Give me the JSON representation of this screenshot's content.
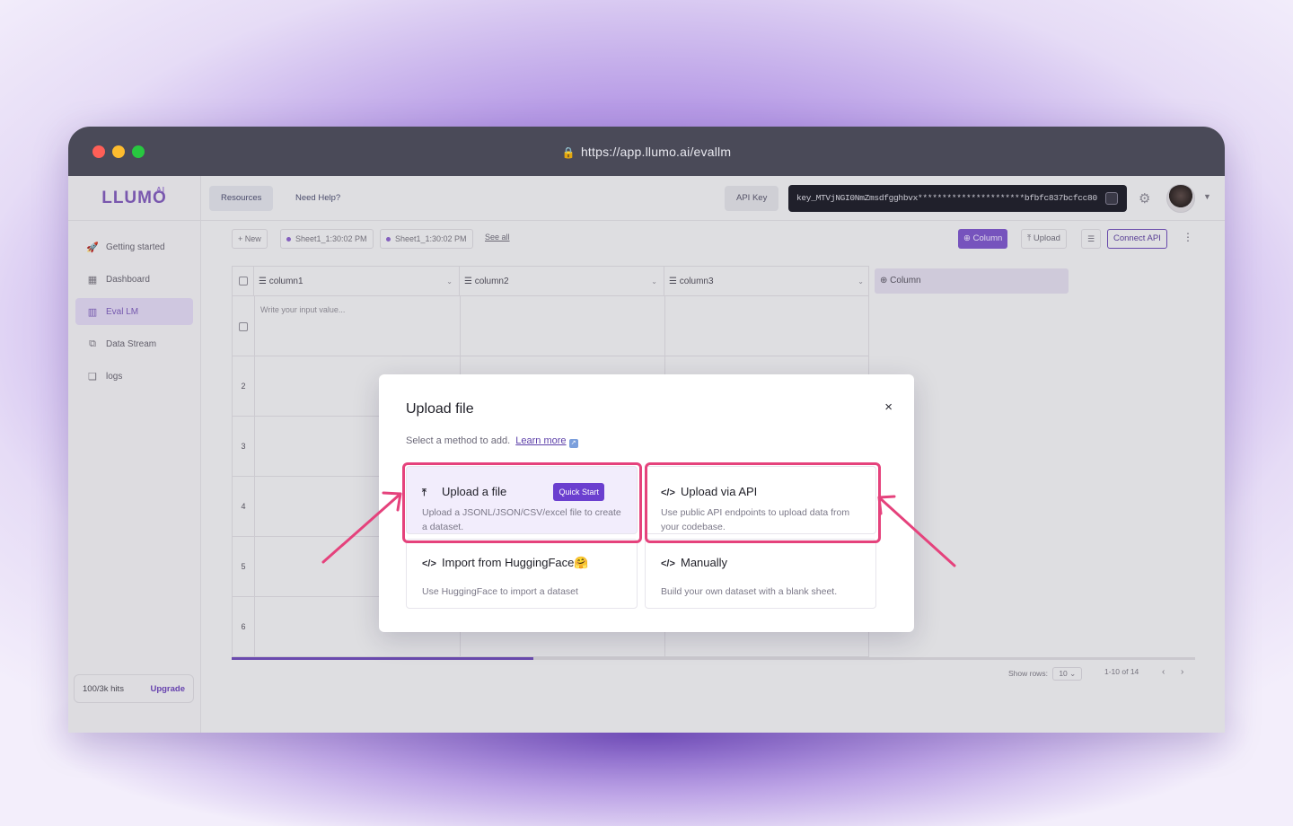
{
  "browser": {
    "url": "https://app.llumo.ai/evallm"
  },
  "brand": {
    "logo_text": "LLUMO",
    "logo_sup": "AI",
    "accent": "#6b3fcf",
    "highlight": "#e5427c"
  },
  "sidebar": {
    "items": [
      {
        "label": "Getting started",
        "icon": "rocket-icon"
      },
      {
        "label": "Dashboard",
        "icon": "dashboard-icon"
      },
      {
        "label": "Eval LM",
        "icon": "chart-icon",
        "active": true
      },
      {
        "label": "Data Stream",
        "icon": "flow-icon"
      },
      {
        "label": "logs",
        "icon": "logs-icon"
      }
    ],
    "hits": "100/3k hits",
    "upgrade": "Upgrade"
  },
  "topbar": {
    "resources": "Resources",
    "help": "Need Help?",
    "api_key_label": "API Key",
    "api_key_value": "key_MTVjNGI0NmZmsdfgghbvx**********************bfbfc837bcfcc80"
  },
  "sheetbar": {
    "new": "+ New",
    "sheets": [
      "Sheet1_1:30:02 PM",
      "Sheet1_1:30:02 PM"
    ],
    "see_all": "See all",
    "column_btn": "⊕ Column",
    "upload_btn": "⤒ Upload",
    "connect_api": "Connect API"
  },
  "grid": {
    "columns": [
      "column1",
      "column2",
      "column3"
    ],
    "add_column": "⊕ Column",
    "placeholder": "Write your input value...",
    "rows": [
      "2",
      "3",
      "4",
      "5",
      "6"
    ],
    "show_rows_label": "Show rows:",
    "show_rows_value": "10",
    "range": "1-10 of 14"
  },
  "modal": {
    "title": "Upload file",
    "close": "×",
    "subtitle": "Select a method to add.",
    "learn_more": "Learn more",
    "cards": [
      {
        "title": "Upload a file",
        "icon": "upload-icon",
        "badge": "Quick Start",
        "desc": "Upload a JSONL/JSON/CSV/excel file to create a dataset."
      },
      {
        "title": "Upload via API",
        "icon": "code-icon",
        "desc": "Use public API endpoints to upload data from your codebase."
      },
      {
        "title": "Import from HuggingFace",
        "icon": "code-icon",
        "emoji": "🤗",
        "desc": "Use HuggingFace to import a dataset"
      },
      {
        "title": "Manually",
        "icon": "code-icon",
        "desc": "Build your own dataset with a blank sheet."
      }
    ]
  }
}
